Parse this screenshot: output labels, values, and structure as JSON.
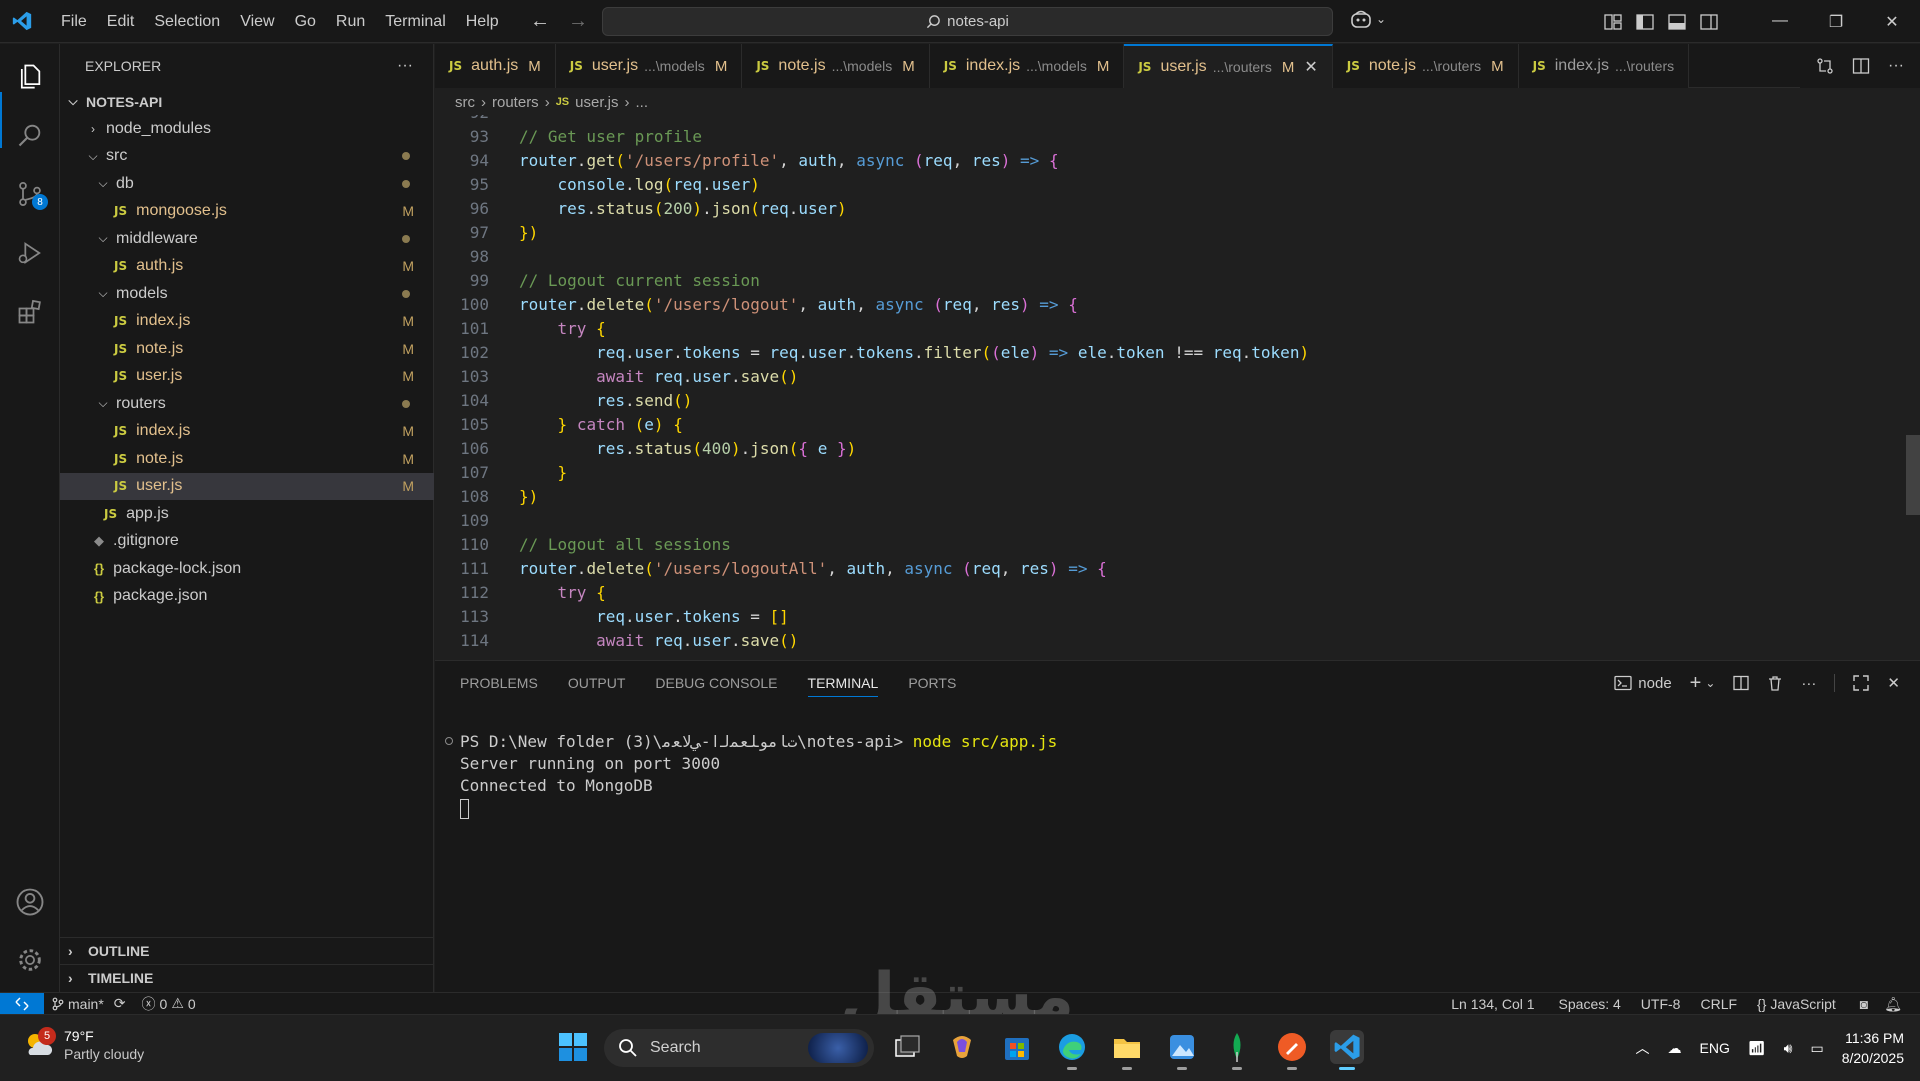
{
  "menu": [
    "File",
    "Edit",
    "Selection",
    "View",
    "Go",
    "Run",
    "Terminal",
    "Help"
  ],
  "command_center": "notes-api",
  "explorer": {
    "title": "EXPLORER",
    "project": "NOTES-API",
    "items": [
      {
        "label": "node_modules",
        "type": "folder-closed",
        "depth": 1,
        "status": ""
      },
      {
        "label": "src",
        "type": "folder-open",
        "depth": 1,
        "status": "dot"
      },
      {
        "label": "db",
        "type": "folder-open",
        "depth": 2,
        "status": "dot"
      },
      {
        "label": "mongoose.js",
        "type": "js",
        "depth": 3,
        "status": "M"
      },
      {
        "label": "middleware",
        "type": "folder-open",
        "depth": 2,
        "status": "dot"
      },
      {
        "label": "auth.js",
        "type": "js",
        "depth": 3,
        "status": "M"
      },
      {
        "label": "models",
        "type": "folder-open",
        "depth": 2,
        "status": "dot"
      },
      {
        "label": "index.js",
        "type": "js",
        "depth": 3,
        "status": "M"
      },
      {
        "label": "note.js",
        "type": "js",
        "depth": 3,
        "status": "M"
      },
      {
        "label": "user.js",
        "type": "js",
        "depth": 3,
        "status": "M"
      },
      {
        "label": "routers",
        "type": "folder-open",
        "depth": 2,
        "status": "dot"
      },
      {
        "label": "index.js",
        "type": "js",
        "depth": 3,
        "status": "M"
      },
      {
        "label": "note.js",
        "type": "js",
        "depth": 3,
        "status": "M"
      },
      {
        "label": "user.js",
        "type": "js",
        "depth": 3,
        "status": "M",
        "selected": true
      },
      {
        "label": "app.js",
        "type": "js",
        "depth": 2,
        "status": ""
      },
      {
        "label": ".gitignore",
        "type": "git",
        "depth": 1,
        "status": ""
      },
      {
        "label": "package-lock.json",
        "type": "json",
        "depth": 1,
        "status": ""
      },
      {
        "label": "package.json",
        "type": "json",
        "depth": 1,
        "status": ""
      }
    ],
    "outline": "OUTLINE",
    "timeline": "TIMELINE"
  },
  "tabs": [
    {
      "name": "auth.js",
      "desc": "",
      "status": "M",
      "active": false
    },
    {
      "name": "user.js",
      "desc": "...\\models",
      "status": "M",
      "active": false
    },
    {
      "name": "note.js",
      "desc": "...\\models",
      "status": "M",
      "active": false
    },
    {
      "name": "index.js",
      "desc": "...\\models",
      "status": "M",
      "active": false
    },
    {
      "name": "user.js",
      "desc": "...\\routers",
      "status": "M",
      "active": true
    },
    {
      "name": "note.js",
      "desc": "...\\routers",
      "status": "M",
      "active": false
    },
    {
      "name": "index.js",
      "desc": "...\\routers",
      "status": "",
      "active": false
    }
  ],
  "breadcrumb": {
    "parts": [
      "src",
      "routers"
    ],
    "file": "user.js",
    "tail": "..."
  },
  "code_lines": [
    {
      "n": "92",
      "t": ""
    },
    {
      "n": "93",
      "t": "// Get user profile"
    },
    {
      "n": "94",
      "t": "router.get('/users/profile', auth, async (req, res) => {"
    },
    {
      "n": "95",
      "t": "    console.log(req.user)"
    },
    {
      "n": "96",
      "t": "    res.status(200).json(req.user)"
    },
    {
      "n": "97",
      "t": "})"
    },
    {
      "n": "98",
      "t": ""
    },
    {
      "n": "99",
      "t": "// Logout current session"
    },
    {
      "n": "100",
      "t": "router.delete('/users/logout', auth, async (req, res) => {"
    },
    {
      "n": "101",
      "t": "    try {"
    },
    {
      "n": "102",
      "t": "        req.user.tokens = req.user.tokens.filter((ele) => ele.token !== req.token)"
    },
    {
      "n": "103",
      "t": "        await req.user.save()"
    },
    {
      "n": "104",
      "t": "        res.send()"
    },
    {
      "n": "105",
      "t": "    } catch (e) {"
    },
    {
      "n": "106",
      "t": "        res.status(400).json({ e })"
    },
    {
      "n": "107",
      "t": "    }"
    },
    {
      "n": "108",
      "t": "})"
    },
    {
      "n": "109",
      "t": ""
    },
    {
      "n": "110",
      "t": "// Logout all sessions"
    },
    {
      "n": "111",
      "t": "router.delete('/users/logoutAll', auth, async (req, res) => {"
    },
    {
      "n": "112",
      "t": "    try {"
    },
    {
      "n": "113",
      "t": "        req.user.tokens = []"
    },
    {
      "n": "114",
      "t": "        await req.user.save()"
    }
  ],
  "panel": {
    "tabs": [
      "PROBLEMS",
      "OUTPUT",
      "DEBUG CONSOLE",
      "TERMINAL",
      "PORTS"
    ],
    "active_tab": "TERMINAL",
    "terminal_name": "node",
    "prompt": "PS D:\\New folder (3)\\ﺕﺎﻣﻮﻠﻌﻤﻟا-ﻲﻟﺎﻌﻣ\\notes-api>",
    "command": "node src/app.js",
    "output": [
      "Server running on port 3000",
      "Connected to MongoDB"
    ]
  },
  "status": {
    "branch": "main*",
    "errors": "0",
    "warnings": "0",
    "position": "Ln 134, Col 1",
    "spaces": "Spaces: 4",
    "encoding": "UTF-8",
    "eol": "CRLF",
    "language": "JavaScript"
  },
  "source_control_badge": "8",
  "taskbar": {
    "weather_temp": "79°F",
    "weather_desc": "Partly cloudy",
    "weather_badge": "5",
    "search": "Search",
    "lang": "ENG",
    "time": "11:36 PM",
    "date": "8/20/2025"
  },
  "watermark": "مستقل"
}
